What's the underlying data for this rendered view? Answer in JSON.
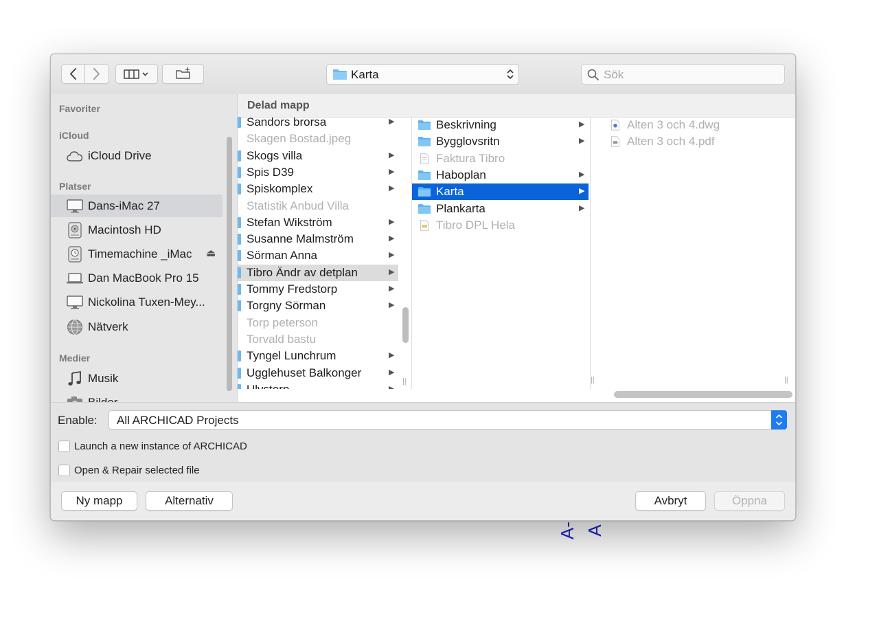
{
  "background": {
    "text": "A-A"
  },
  "toolbar": {
    "current_folder": "Karta",
    "search_placeholder": "Sök"
  },
  "sidebar": {
    "sections": {
      "favorites": "Favoriter",
      "icloud": "iCloud",
      "places": "Platser",
      "media": "Medier"
    },
    "items": {
      "icloud_drive": "iCloud Drive",
      "dans_imac": "Dans-iMac 27",
      "macintosh_hd": "Macintosh HD",
      "timemachine": "Timemachine _iMac",
      "macbook": "Dan MacBook Pro 15",
      "nickolina": "Nickolina  Tuxen-Mey...",
      "network": "Nätverk",
      "music": "Musik",
      "pictures": "Bilder"
    }
  },
  "browser": {
    "header": "Delad mapp",
    "column1": [
      {
        "label": "Sandors brorsa",
        "kind": "folder"
      },
      {
        "label": "Skagen Bostad.jpeg",
        "kind": "file"
      },
      {
        "label": "Skogs villa",
        "kind": "folder"
      },
      {
        "label": "Spis D39",
        "kind": "folder"
      },
      {
        "label": "Spiskomplex",
        "kind": "folder"
      },
      {
        "label": "Statistik Anbud Villa",
        "kind": "file"
      },
      {
        "label": "Stefan Wikström",
        "kind": "folder"
      },
      {
        "label": "Susanne Malmström",
        "kind": "folder"
      },
      {
        "label": "Sörman Anna",
        "kind": "folder"
      },
      {
        "label": "Tibro Ändr av detplan",
        "kind": "folder"
      },
      {
        "label": "Tommy Fredstorp",
        "kind": "folder"
      },
      {
        "label": "Torgny Sörman",
        "kind": "folder"
      },
      {
        "label": "Torp peterson",
        "kind": "file"
      },
      {
        "label": "Torvald bastu",
        "kind": "file"
      },
      {
        "label": "Tyngel Lunchrum",
        "kind": "folder"
      },
      {
        "label": "Ugglehuset Balkonger",
        "kind": "folder"
      },
      {
        "label": "Ulvstorp",
        "kind": "folder"
      }
    ],
    "column2": [
      {
        "label": "Beskrivning",
        "kind": "folder"
      },
      {
        "label": "Bygglovsritn",
        "kind": "folder"
      },
      {
        "label": "Faktura Tibro",
        "kind": "file"
      },
      {
        "label": "Haboplan",
        "kind": "folder"
      },
      {
        "label": "Karta",
        "kind": "folder"
      },
      {
        "label": "Plankarta",
        "kind": "folder"
      },
      {
        "label": "Tibro DPL Hela",
        "kind": "file"
      }
    ],
    "column3": [
      {
        "label": "Alten 3 och 4.dwg",
        "kind": "dwg"
      },
      {
        "label": "Alten 3 och 4.pdf",
        "kind": "pdf"
      }
    ]
  },
  "options": {
    "enable_label": "Enable:",
    "enable_value": "All ARCHICAD Projects",
    "launch_label": "Launch a new instance of ARCHICAD",
    "repair_label": "Open & Repair selected file"
  },
  "buttons": {
    "new_folder": "Ny mapp",
    "options": "Alternativ",
    "cancel": "Avbryt",
    "open": "Öppna"
  }
}
